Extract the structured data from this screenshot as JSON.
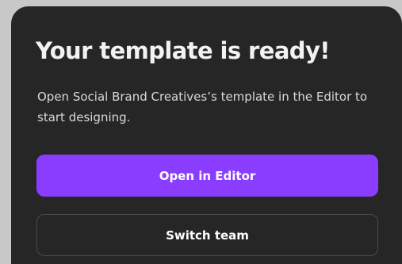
{
  "dialog": {
    "title": "Your template is ready!",
    "description": "Open Social Brand Creatives’s template in the Editor to start designing.",
    "primary_button_label": "Open in Editor",
    "secondary_button_label": "Switch team"
  },
  "colors": {
    "dialog_background": "#262626",
    "primary_accent": "#8b3dff",
    "page_background": "#c8c8c8"
  }
}
